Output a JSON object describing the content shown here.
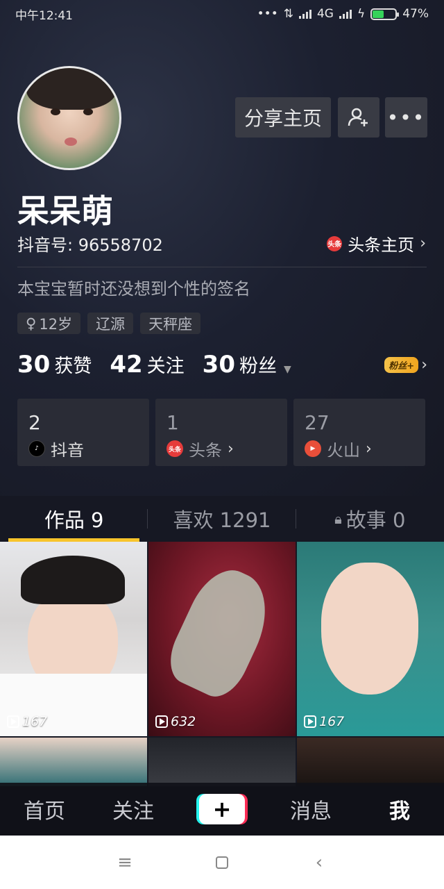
{
  "status_bar": {
    "time": "中午12:41",
    "network": "4G",
    "battery": "47%",
    "battery_level": 0.47
  },
  "profile": {
    "name": "呆呆萌",
    "id_label": "抖音号: 96558702",
    "toutiao_label": "头条主页",
    "signature": "本宝宝暂时还没想到个性的签名",
    "tags": [
      "12岁",
      "辽源",
      "天秤座"
    ],
    "share_label": "分享主页",
    "more_label": "•••"
  },
  "stats": {
    "likes_num": "30",
    "likes_label": "获赞",
    "following_num": "42",
    "following_label": "关注",
    "fans_num": "30",
    "fans_label": "粉丝",
    "fans_plus": "粉丝+"
  },
  "platform_cards": [
    {
      "count": "2",
      "app": "抖音",
      "badge": "♪"
    },
    {
      "count": "1",
      "app": "头条",
      "badge": "头条"
    },
    {
      "count": "27",
      "app": "火山",
      "badge": "▶"
    }
  ],
  "tabs": [
    {
      "label": "作品 9"
    },
    {
      "label": "喜欢 1291"
    },
    {
      "label": "故事 0"
    }
  ],
  "videos": [
    {
      "plays": "167"
    },
    {
      "plays": "632"
    },
    {
      "plays": "167"
    }
  ],
  "bottom_nav": {
    "home": "首页",
    "follow": "关注",
    "plus": "+",
    "messages": "消息",
    "me": "我"
  },
  "colors": {
    "background": "#161823",
    "tab_indicator": "#f7c42b",
    "toutiao_red": "#e63b3b"
  }
}
